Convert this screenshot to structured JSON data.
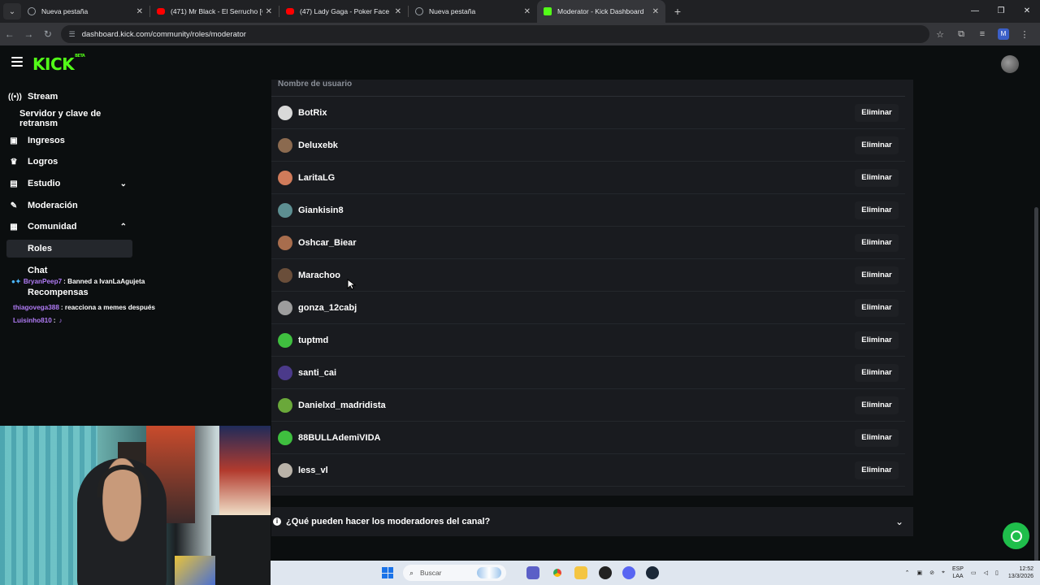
{
  "browser": {
    "tabs": [
      {
        "title": "Nueva pestaña",
        "favicon_color": "#9aa0a6",
        "active": false
      },
      {
        "title": "(471) Mr Black - El Serrucho [O",
        "favicon_color": "#ff0000",
        "active": false
      },
      {
        "title": "(47) Lady Gaga - Poker Face (O",
        "favicon_color": "#ff0000",
        "active": false
      },
      {
        "title": "Nueva pestaña",
        "favicon_color": "#9aa0a6",
        "active": false
      },
      {
        "title": "Moderator - Kick Dashboard",
        "favicon_color": "#53fc18",
        "active": true
      }
    ],
    "url": "dashboard.kick.com/community/roles/moderator",
    "profile_initial": "M"
  },
  "kick": {
    "logo": "KICK",
    "logo_badge": "BETA"
  },
  "sidebar": {
    "items": [
      {
        "label": "Stream",
        "icon": "broadcast-icon"
      },
      {
        "label": "Servidor y clave de retransm",
        "icon": ""
      },
      {
        "label": "Ingresos",
        "icon": "money-icon"
      },
      {
        "label": "Logros",
        "icon": "trophy-icon"
      },
      {
        "label": "Estudio",
        "icon": "studio-icon"
      },
      {
        "label": "Moderación",
        "icon": "wrench-icon"
      },
      {
        "label": "Comunidad",
        "icon": "community-icon"
      },
      {
        "label": "Roles",
        "icon": ""
      },
      {
        "label": "Chat",
        "icon": ""
      },
      {
        "label": "Recompensas",
        "icon": ""
      }
    ]
  },
  "chat_overlay": [
    {
      "user": "BryanPeep7",
      "message": ": Banned a IvanLaAgujeta"
    },
    {
      "user": "",
      "message": ""
    },
    {
      "user": "thiagovega388",
      "message": ": reacciona a memes después"
    },
    {
      "user": "Luisinho810",
      "message": ":"
    }
  ],
  "moderators": {
    "column_header": "Nombre de usuario",
    "remove_label": "Eliminar",
    "users": [
      {
        "name": "BotRix",
        "avatar_color": "#d9d9d9"
      },
      {
        "name": "Deluxebk",
        "avatar_color": "#8b6a4f"
      },
      {
        "name": "LaritaLG",
        "avatar_color": "#d07b5a"
      },
      {
        "name": "Giankisin8",
        "avatar_color": "#5d8f92"
      },
      {
        "name": "Oshcar_Biear",
        "avatar_color": "#a86d4d"
      },
      {
        "name": "Marachoo",
        "avatar_color": "#6a4e3a"
      },
      {
        "name": "gonza_12cabj",
        "avatar_color": "#9d9d9d"
      },
      {
        "name": "tuptmd",
        "avatar_color": "#3fbf3f"
      },
      {
        "name": "santi_cai",
        "avatar_color": "#4b3a8a"
      },
      {
        "name": "Danielxd_madridista",
        "avatar_color": "#6aa83a"
      },
      {
        "name": "88BULLAdemiVIDA",
        "avatar_color": "#3fbf3f"
      },
      {
        "name": "less_vl",
        "avatar_color": "#b9b2a8"
      }
    ]
  },
  "faq": {
    "question": "¿Qué pueden hacer los moderadores del canal?"
  },
  "taskbar": {
    "search_placeholder": "Buscar",
    "lang_top": "ESP",
    "lang_bottom": "LAA",
    "time": "12:52",
    "date": "13/3/2026"
  }
}
